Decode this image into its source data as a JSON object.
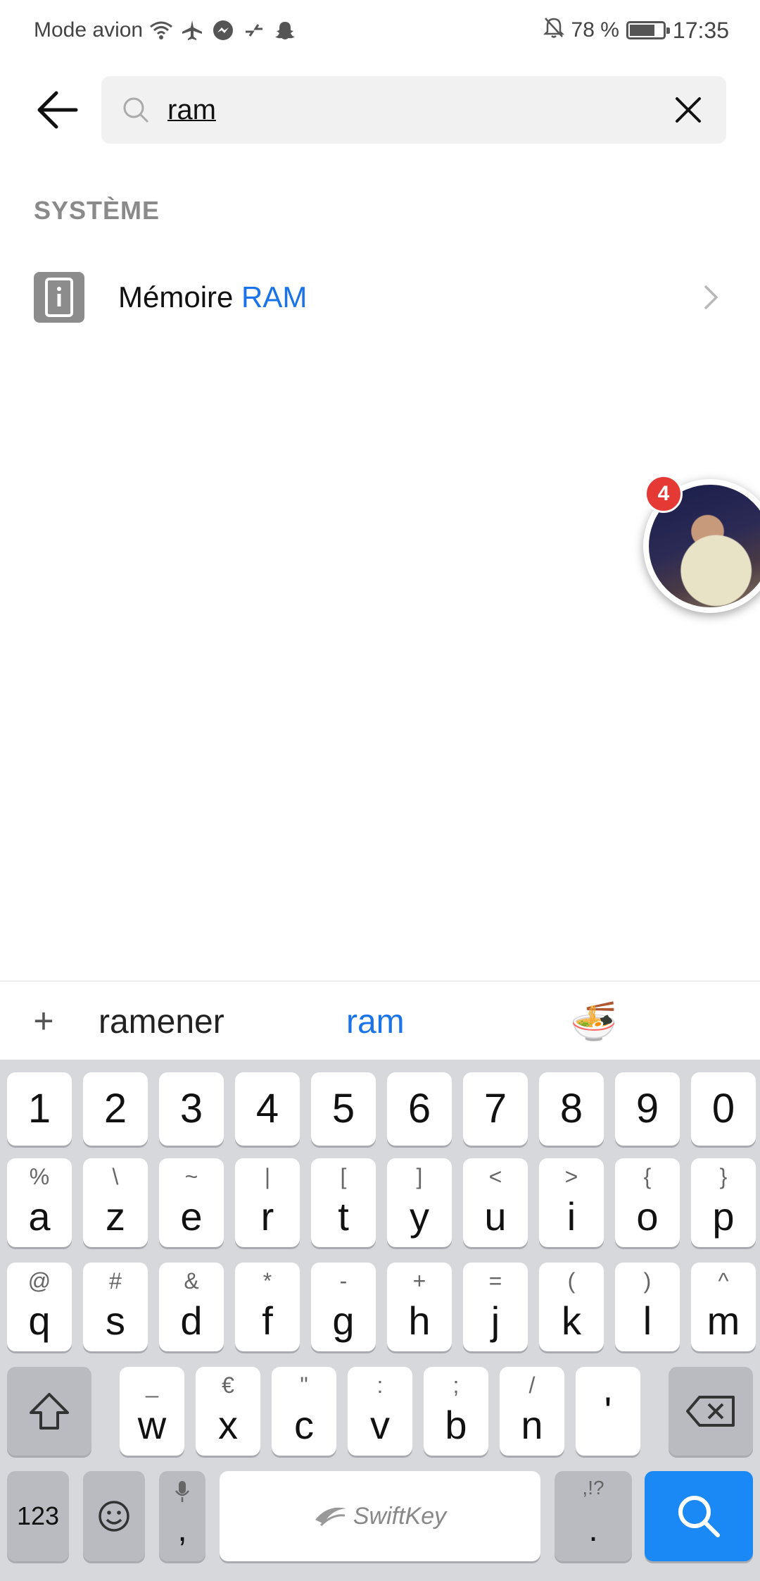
{
  "status_bar": {
    "mode": "Mode avion",
    "battery": "78 %",
    "time": "17:35",
    "icons": [
      "wifi-icon",
      "airplane-icon",
      "messenger-icon",
      "data-saver-icon",
      "snapchat-icon"
    ]
  },
  "search": {
    "query": "ram",
    "back_icon": "arrow-left-icon",
    "clear_icon": "close-icon"
  },
  "section": {
    "header": "SYSTÈME"
  },
  "results": [
    {
      "prefix": "Mémoire ",
      "highlight": "RAM",
      "icon": "info-phone-icon"
    }
  ],
  "chat_head": {
    "badge_count": "4"
  },
  "suggestions": {
    "add": "+",
    "word1": "ramener",
    "word2": "ram",
    "emoji": "🍜"
  },
  "keyboard": {
    "numbers": [
      "1",
      "2",
      "3",
      "4",
      "5",
      "6",
      "7",
      "8",
      "9",
      "0"
    ],
    "row1": [
      {
        "k": "a",
        "s": "%"
      },
      {
        "k": "z",
        "s": "\\"
      },
      {
        "k": "e",
        "s": "~"
      },
      {
        "k": "r",
        "s": "|"
      },
      {
        "k": "t",
        "s": "["
      },
      {
        "k": "y",
        "s": "]"
      },
      {
        "k": "u",
        "s": "<"
      },
      {
        "k": "i",
        "s": ">"
      },
      {
        "k": "o",
        "s": "{"
      },
      {
        "k": "p",
        "s": "}"
      }
    ],
    "row2": [
      {
        "k": "q",
        "s": "@"
      },
      {
        "k": "s",
        "s": "#"
      },
      {
        "k": "d",
        "s": "&"
      },
      {
        "k": "f",
        "s": "*"
      },
      {
        "k": "g",
        "s": "-"
      },
      {
        "k": "h",
        "s": "+"
      },
      {
        "k": "j",
        "s": "="
      },
      {
        "k": "k",
        "s": "("
      },
      {
        "k": "l",
        "s": ")"
      },
      {
        "k": "m",
        "s": "^"
      }
    ],
    "row3": [
      {
        "k": "w",
        "s": "_"
      },
      {
        "k": "x",
        "s": "€"
      },
      {
        "k": "c",
        "s": "\""
      },
      {
        "k": "v",
        "s": ":"
      },
      {
        "k": "b",
        "s": ";"
      },
      {
        "k": "n",
        "s": "/"
      },
      {
        "k": "'",
        "s": ""
      }
    ],
    "numbers_key": "123",
    "comma_key": ",",
    "period_key": ".",
    "period_sub": ",!?",
    "space_brand": "SwiftKey"
  },
  "colors": {
    "accent": "#1a73e8",
    "keyboard_bg": "#d7d8dc",
    "search_key": "#1a88f5",
    "badge": "#e53935"
  }
}
